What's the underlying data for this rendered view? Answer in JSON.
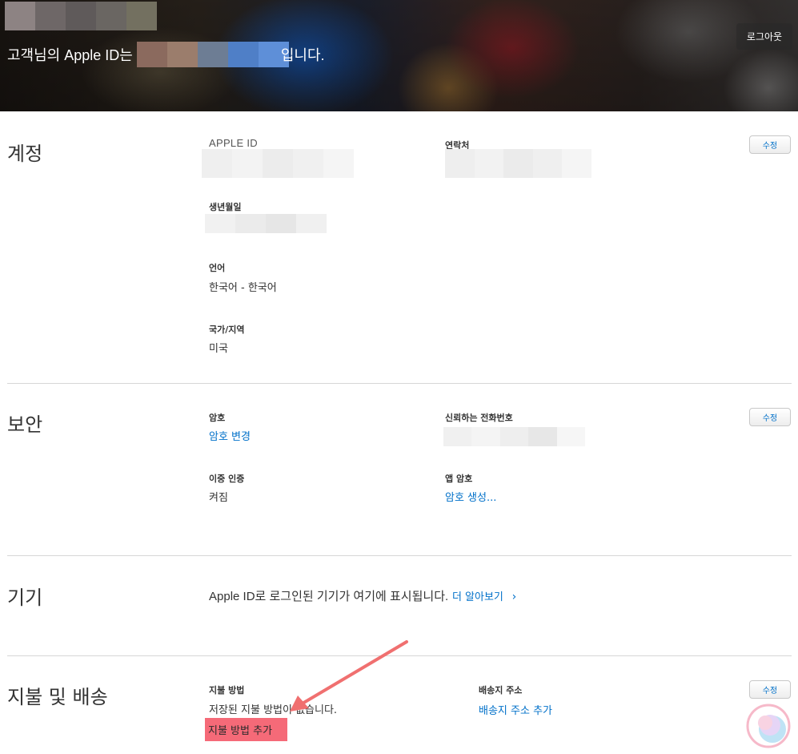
{
  "header": {
    "greeting_before": "고객님의 Apple ID는",
    "greeting_after": "입니다.",
    "logout_label": "로그아웃"
  },
  "account": {
    "title": "계정",
    "edit_label": "수정",
    "apple_id_label": "APPLE ID",
    "contact_label": "연락처",
    "birthday_label": "생년월일",
    "language_label": "언어",
    "language_value": "한국어 - 한국어",
    "country_label": "국가/지역",
    "country_value": "미국"
  },
  "security": {
    "title": "보안",
    "edit_label": "수정",
    "password_label": "암호",
    "change_password_link": "암호 변경",
    "trusted_phone_label": "신뢰하는 전화번호",
    "two_factor_label": "이중 인증",
    "two_factor_value": "켜짐",
    "app_password_label": "앱 암호",
    "generate_password_link": "암호 생성..."
  },
  "devices": {
    "title": "기기",
    "message": "Apple ID로 로그인된 기기가 여기에 표시됩니다.",
    "learn_more_link": "더 알아보기",
    "chevron_icon": "chevron-right-icon"
  },
  "payment": {
    "title": "지불 및 배송",
    "edit_label": "수정",
    "payment_method_label": "지불 방법",
    "payment_method_value": "저장된 지불 방법이 없습니다.",
    "add_payment_link": "지불 방법 추가",
    "shipping_label": "배송지 주소",
    "add_shipping_link": "배송지 주소 추가"
  },
  "colors": {
    "link": "#0070c9",
    "highlight": "#f56a78",
    "annotation_arrow": "#f07070"
  }
}
